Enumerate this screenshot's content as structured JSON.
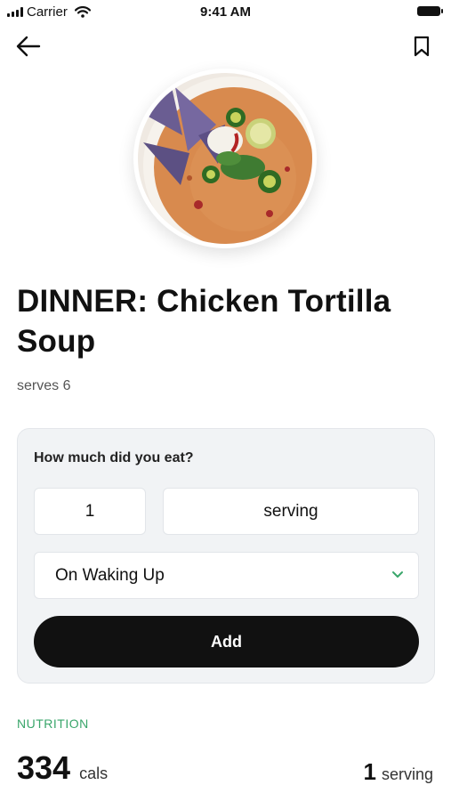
{
  "status_bar": {
    "carrier": "Carrier",
    "time": "9:41 AM"
  },
  "nav": {
    "back_icon": "arrow-left-icon",
    "bookmark_icon": "bookmark-icon"
  },
  "recipe": {
    "title": "DINNER: Chicken Tortilla Soup",
    "serves": "serves 6"
  },
  "log_card": {
    "question": "How much did you eat?",
    "quantity": "1",
    "unit": "serving",
    "meal": "On Waking Up",
    "add_label": "Add"
  },
  "nutrition": {
    "label": "NUTRITION",
    "calories": "334",
    "calories_unit": "cals",
    "serving_count": "1",
    "serving_unit": "serving"
  },
  "colors": {
    "accent_green": "#3aa66b",
    "button_black": "#111111",
    "card_bg": "#f1f3f5"
  }
}
